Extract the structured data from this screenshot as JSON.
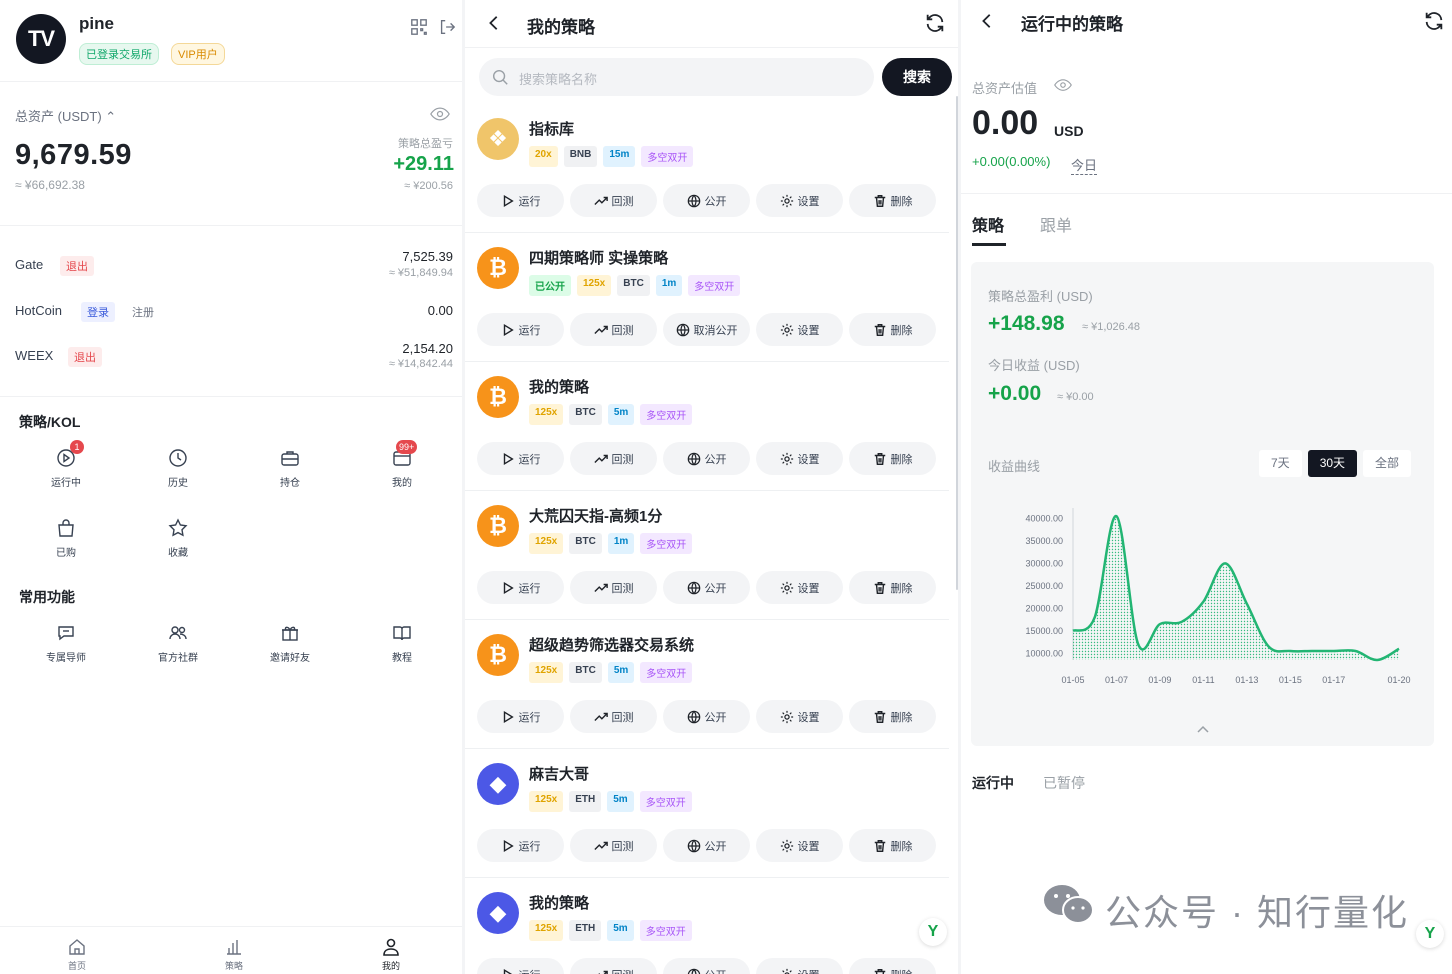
{
  "account": {
    "logo_text": "TV",
    "username": "pine",
    "badge_exchange": "已登录交易所",
    "badge_vip": "VIP用户",
    "total_assets_label": "总资产 (USDT)",
    "total_assets_value": "9,679.59",
    "total_assets_cny": "≈ ¥66,692.38",
    "strategy_pnl_label": "策略总盈亏",
    "strategy_pnl_value": "+29.11",
    "strategy_pnl_cny": "≈ ¥200.56"
  },
  "exchanges": [
    {
      "name": "Gate",
      "actions": [
        "退出"
      ],
      "value": "7,525.39",
      "cny": "≈ ¥51,849.94"
    },
    {
      "name": "HotCoin",
      "actions": [
        "登录",
        "注册"
      ],
      "value": "0.00",
      "cny": ""
    },
    {
      "name": "WEEX",
      "actions": [
        "退出"
      ],
      "value": "2,154.20",
      "cny": "≈ ¥14,842.44"
    }
  ],
  "strategy_section": {
    "title": "策略/KOL",
    "items": [
      {
        "label": "运行中",
        "icon": "play-circle-icon",
        "badge": "1"
      },
      {
        "label": "历史",
        "icon": "clock-icon",
        "badge": ""
      },
      {
        "label": "持仓",
        "icon": "briefcase-icon",
        "badge": ""
      },
      {
        "label": "我的",
        "icon": "wallet-icon",
        "badge": "99+"
      },
      {
        "label": "已购",
        "icon": "shopping-bag-icon",
        "badge": ""
      },
      {
        "label": "收藏",
        "icon": "star-icon",
        "badge": ""
      }
    ]
  },
  "common_section": {
    "title": "常用功能",
    "items": [
      {
        "label": "专属导师",
        "icon": "chat-icon"
      },
      {
        "label": "官方社群",
        "icon": "group-icon"
      },
      {
        "label": "邀请好友",
        "icon": "gift-icon"
      },
      {
        "label": "教程",
        "icon": "book-icon"
      }
    ]
  },
  "bottom_nav": [
    {
      "label": "首页",
      "icon": "home-icon"
    },
    {
      "label": "策略",
      "icon": "bar-chart-icon"
    },
    {
      "label": "我的",
      "icon": "user-icon"
    }
  ],
  "my_strategies": {
    "title": "我的策略",
    "search_placeholder": "搜索策略名称",
    "search_button": "搜索",
    "cards": [
      {
        "name": "指标库",
        "coin": "bnb",
        "tags": [
          "20x",
          "BNB",
          "15m",
          "多空双开"
        ],
        "public_state": "",
        "publish_label": "公开"
      },
      {
        "name": "四期策略师 实操策略",
        "coin": "btc",
        "tags": [
          "125x",
          "BTC",
          "1m",
          "多空双开"
        ],
        "public_state": "已公开",
        "publish_label": "取消公开"
      },
      {
        "name": "我的策略",
        "coin": "btc",
        "tags": [
          "125x",
          "BTC",
          "5m",
          "多空双开"
        ],
        "public_state": "",
        "publish_label": "公开"
      },
      {
        "name": "大荒囚天指-高频1分",
        "coin": "btc",
        "tags": [
          "125x",
          "BTC",
          "1m",
          "多空双开"
        ],
        "public_state": "",
        "publish_label": "公开"
      },
      {
        "name": "超级趋势筛选器交易系统",
        "coin": "btc",
        "tags": [
          "125x",
          "BTC",
          "5m",
          "多空双开"
        ],
        "public_state": "",
        "publish_label": "公开"
      },
      {
        "name": "麻吉大哥",
        "coin": "eth",
        "tags": [
          "125x",
          "ETH",
          "5m",
          "多空双开"
        ],
        "public_state": "",
        "publish_label": "公开"
      },
      {
        "name": "我的策略",
        "coin": "eth",
        "tags": [
          "125x",
          "ETH",
          "5m",
          "多空双开"
        ],
        "public_state": "",
        "publish_label": "公开"
      }
    ],
    "action_labels": {
      "run": "运行",
      "backtest": "回测",
      "settings": "设置",
      "delete": "删除"
    },
    "coin_glyphs": {
      "bnb": "❖",
      "btc": "₿",
      "eth": "◆"
    }
  },
  "running": {
    "title": "运行中的策略",
    "asset_label": "总资产估值",
    "asset_value": "0.00",
    "asset_unit": "USD",
    "asset_change": "+0.00(0.00%)",
    "asset_period": "今日",
    "tabs": [
      "策略",
      "跟单"
    ],
    "total_pnl_label": "策略总盈利 (USD)",
    "total_pnl_value": "+148.98",
    "total_pnl_cny": "≈ ¥1,026.48",
    "today_pnl_label": "今日收益 (USD)",
    "today_pnl_value": "+0.00",
    "today_pnl_cny": "≈ ¥0.00",
    "curve_label": "收益曲线",
    "ranges": [
      "7天",
      "30天",
      "全部"
    ],
    "active_range": "30天",
    "sub_tabs": [
      "运行中",
      "已暂停"
    ],
    "watermark": "公众号 · 知行量化"
  },
  "chart_data": {
    "type": "area",
    "title": "",
    "x": [
      "01-05",
      "01-06",
      "01-07",
      "01-08",
      "01-09",
      "01-10",
      "01-11",
      "01-12",
      "01-13",
      "01-14",
      "01-15",
      "01-16",
      "01-17",
      "01-18",
      "01-19",
      "01-20"
    ],
    "x_ticks": [
      "01-05",
      "01-07",
      "01-09",
      "01-11",
      "01-13",
      "01-15",
      "01-17",
      "01-20"
    ],
    "series": [
      {
        "values": [
          15000,
          18000,
          40500,
          12000,
          16500,
          17000,
          21500,
          30000,
          21000,
          11500,
          10500,
          10500,
          10500,
          10500,
          8500,
          11000
        ]
      }
    ],
    "y_ticks": [
      10000,
      15000,
      20000,
      25000,
      30000,
      35000,
      40000
    ],
    "y_tick_labels": [
      "10000.00",
      "15000.00",
      "20000.00",
      "25000.00",
      "30000.00",
      "35000.00",
      "40000.00"
    ],
    "ylim": [
      8500,
      41000
    ],
    "color": "#22b573",
    "grid": false
  }
}
